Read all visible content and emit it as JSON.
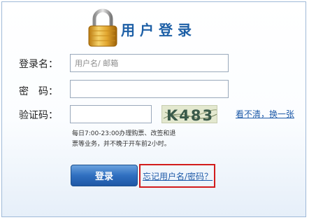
{
  "header": {
    "title": "用户登录",
    "icon": "lock-icon"
  },
  "form": {
    "username_label": "登录名：",
    "username_placeholder": "用户名/ 邮箱",
    "password_label": "密　码：",
    "captcha_label": "验证码：",
    "captcha_text": "K483",
    "refresh_link": "看不清，换一张"
  },
  "note": {
    "line1": "每日7:00-23:00办理购票、改签和退",
    "line2": "票等业务，并不晚于开车前2小时。"
  },
  "actions": {
    "login_label": "登录",
    "forgot_label": "忘记用户名/密码？"
  },
  "colors": {
    "title": "#1d5fa6",
    "button": "#2f6fc0",
    "highlight_box": "#d21c1c"
  }
}
